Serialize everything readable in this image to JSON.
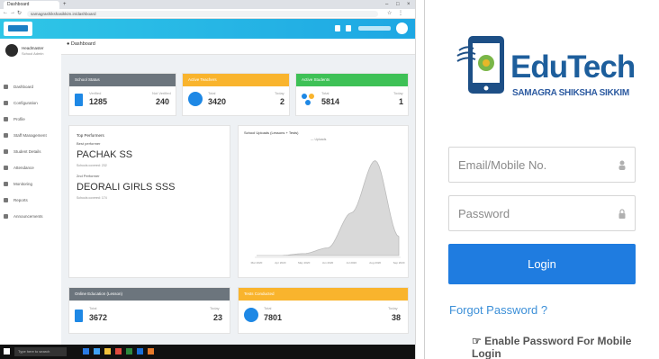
{
  "browser": {
    "tab_title": "Dashboard",
    "address": "samagrashikshasikkim.in/dashboard"
  },
  "dashboard": {
    "breadcrumb": "Dashboard",
    "user": {
      "name": "Headmaster",
      "role": "School Admin"
    },
    "sidebar": [
      {
        "label": "Dashboard"
      },
      {
        "label": "Configuration"
      },
      {
        "label": "Profile"
      },
      {
        "label": "Staff Management"
      },
      {
        "label": "Student Details"
      },
      {
        "label": "Attendance"
      },
      {
        "label": "Monitoring"
      },
      {
        "label": "Reports"
      },
      {
        "label": "Announcements"
      }
    ],
    "cards": {
      "school_status": {
        "header": "School Status",
        "left_label": "Verified",
        "left_value": "1285",
        "right_label": "Not Verified",
        "right_value": "240",
        "color": "#6c757d"
      },
      "active_teachers": {
        "header": "Active Teachers",
        "left_label": "Total",
        "left_value": "3420",
        "right_label": "Today",
        "right_value": "2",
        "color": "#f9b42d"
      },
      "active_students": {
        "header": "Active Students",
        "left_label": "Total",
        "left_value": "5814",
        "right_label": "Today",
        "right_value": "1",
        "color": "#3ec156"
      },
      "online_education": {
        "header": "Online Education (Lesson)",
        "left_label": "Total",
        "left_value": "3672",
        "right_label": "Today",
        "right_value": "23",
        "color": "#6c757d"
      },
      "tests": {
        "header": "Tests Conducted",
        "left_label": "Total",
        "left_value": "7801",
        "right_label": "Today",
        "right_value": "38",
        "color": "#f9b42d"
      }
    },
    "top_performers": {
      "title": "Top Performers",
      "first_label": "Best performer",
      "first_school": "PACHAK SS",
      "first_meta": "Schools covered: 232",
      "second_label": "2nd Performer",
      "second_school": "DEORALI GIRLS SSS",
      "second_meta": "Schools covered: 174"
    },
    "chart_title": "School Uploads (Lessons + Tests)",
    "chart_legend": "Uploads"
  },
  "chart_data": {
    "type": "area",
    "title": "School Uploads (Lessons + Tests)",
    "x": [
      "Mar 2020",
      "Apr 2020",
      "May 2020",
      "Jun 2020",
      "Jul 2020",
      "Aug 2020",
      "Sep 2020"
    ],
    "series": [
      {
        "name": "Uploads",
        "values": [
          0,
          0,
          2,
          8,
          45,
          100,
          20
        ]
      }
    ],
    "ylim": [
      0,
      110
    ]
  },
  "login": {
    "brand_title": "EduTech",
    "brand_subtitle": "SAMAGRA SHIKSHA SIKKIM",
    "email_placeholder": "Email/Mobile No.",
    "password_placeholder": "Password",
    "login_button": "Login",
    "forgot_password": "Forgot Password ?",
    "enable_password": "Enable Password For Mobile Login"
  },
  "taskbar": {
    "search": "Type here to search"
  },
  "colors": {
    "primary": "#1f7ce0",
    "brand": "#1d5e9c"
  }
}
